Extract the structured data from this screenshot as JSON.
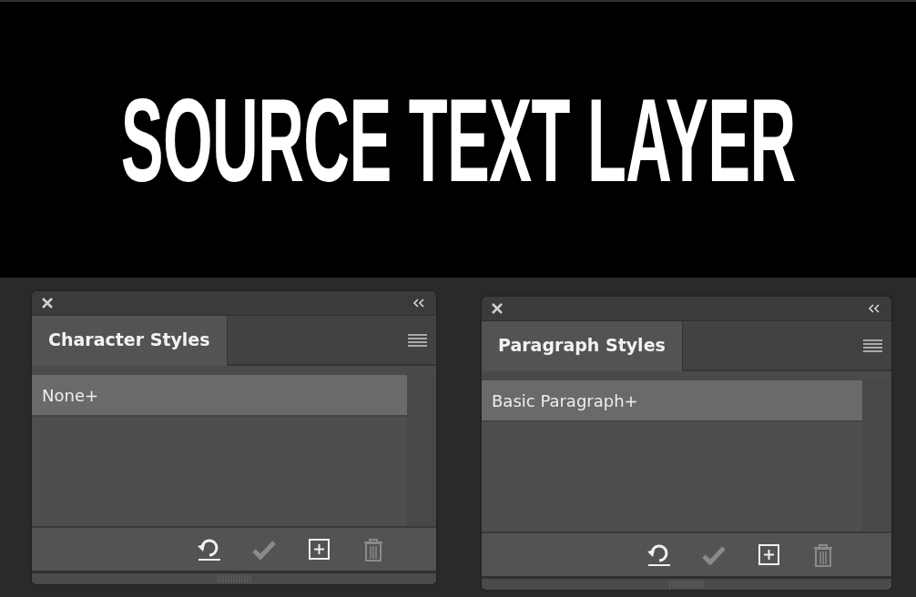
{
  "canvas": {
    "text": "SOURCE TEXT LAYER"
  },
  "panels": [
    {
      "tabs": [
        {
          "label": "Character Styles",
          "selected": true
        }
      ],
      "items": [
        {
          "label": "None+",
          "selected": true
        }
      ],
      "buttons": [
        {
          "kind": "clear",
          "disabled": false
        },
        {
          "kind": "apply",
          "disabled": true
        },
        {
          "kind": "new",
          "disabled": false
        },
        {
          "kind": "delete",
          "disabled": true
        }
      ]
    },
    {
      "tabs": [
        {
          "label": "Paragraph Styles",
          "selected": true
        }
      ],
      "items": [
        {
          "label": "Basic Paragraph+",
          "selected": true
        }
      ],
      "buttons": [
        {
          "kind": "clear",
          "disabled": false
        },
        {
          "kind": "apply",
          "disabled": true
        },
        {
          "kind": "new",
          "disabled": false
        },
        {
          "kind": "delete",
          "disabled": true
        }
      ]
    }
  ]
}
